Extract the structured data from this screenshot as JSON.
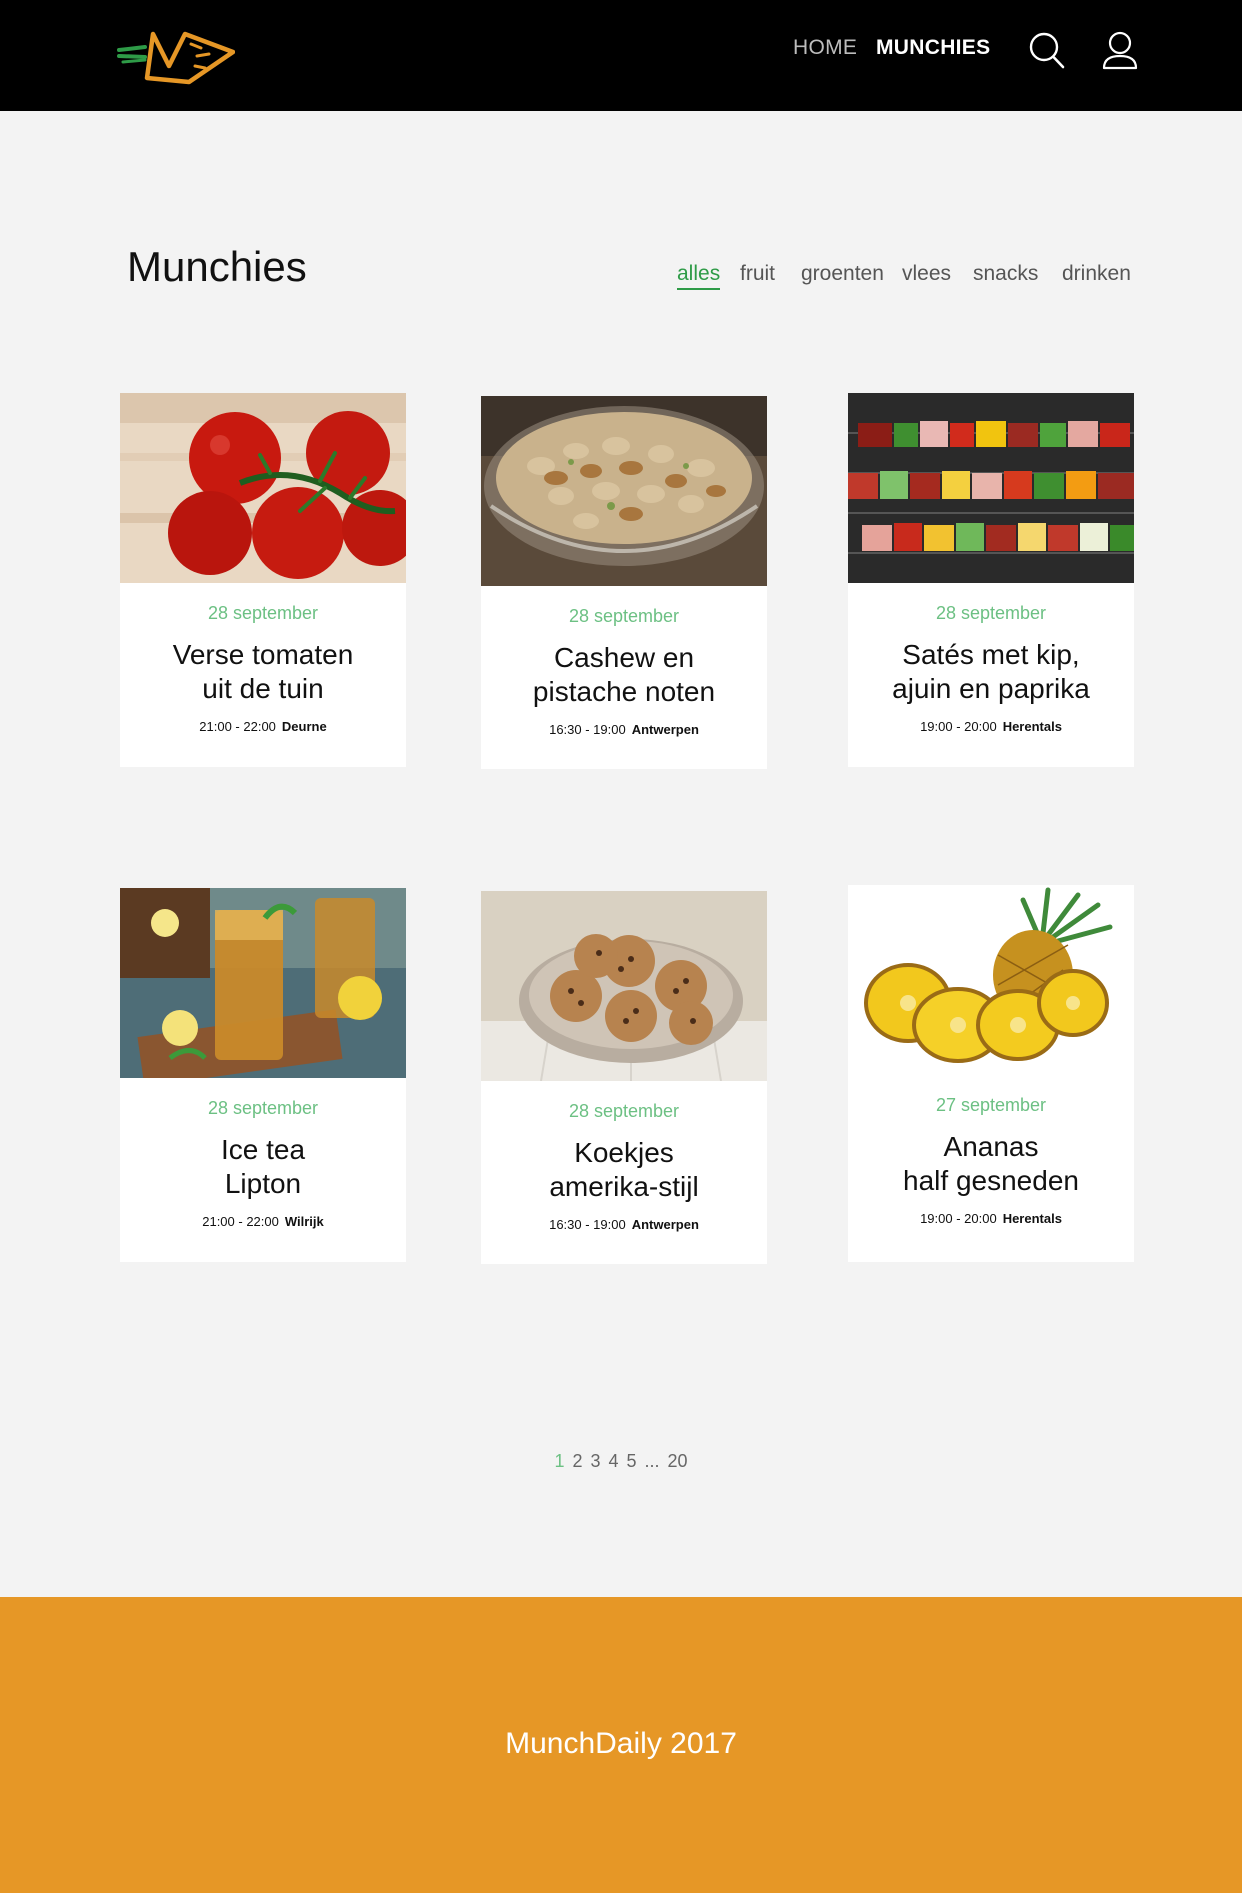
{
  "brand": {
    "name": "logo",
    "colors": {
      "orange": "#e69726",
      "green": "#2e9b47"
    }
  },
  "nav": {
    "home": "HOME",
    "munchies": "MUNCHIES",
    "search_icon": "search-icon",
    "user_icon": "user-icon"
  },
  "page": {
    "title": "Munchies"
  },
  "filters": [
    "alles",
    "fruit",
    "groenten",
    "vlees",
    "snacks",
    "drinken"
  ],
  "active_filter": "alles",
  "cards": [
    {
      "date": "28 september",
      "title_line1": "Verse tomaten",
      "title_line2": "uit de tuin",
      "time": "21:00 - 22:00",
      "location": "Deurne",
      "image": "tomatoes"
    },
    {
      "date": "28 september",
      "title_line1": "Cashew en",
      "title_line2": "pistache noten",
      "time": "16:30 - 19:00",
      "location": "Antwerpen",
      "image": "nuts-bowl"
    },
    {
      "date": "28 september",
      "title_line1": "Satés met kip,",
      "title_line2": "ajuin en paprika",
      "time": "19:00 - 20:00",
      "location": "Herentals",
      "image": "skewers"
    },
    {
      "date": "28 september",
      "title_line1": "Ice tea",
      "title_line2": "Lipton",
      "time": "21:00 - 22:00",
      "location": "Wilrijk",
      "image": "ice-tea"
    },
    {
      "date": "28 september",
      "title_line1": "Koekjes",
      "title_line2": "amerika-stijl",
      "time": "16:30 - 19:00",
      "location": "Antwerpen",
      "image": "cookies"
    },
    {
      "date": "27 september",
      "title_line1": "Ananas",
      "title_line2": "half gesneden",
      "time": "19:00 - 20:00",
      "location": "Herentals",
      "image": "pineapple"
    }
  ],
  "pagination": {
    "pages": [
      "1",
      "2",
      "3",
      "4",
      "5",
      "...",
      "20"
    ],
    "current": "1"
  },
  "footer": {
    "text": "MunchDaily 2017"
  }
}
